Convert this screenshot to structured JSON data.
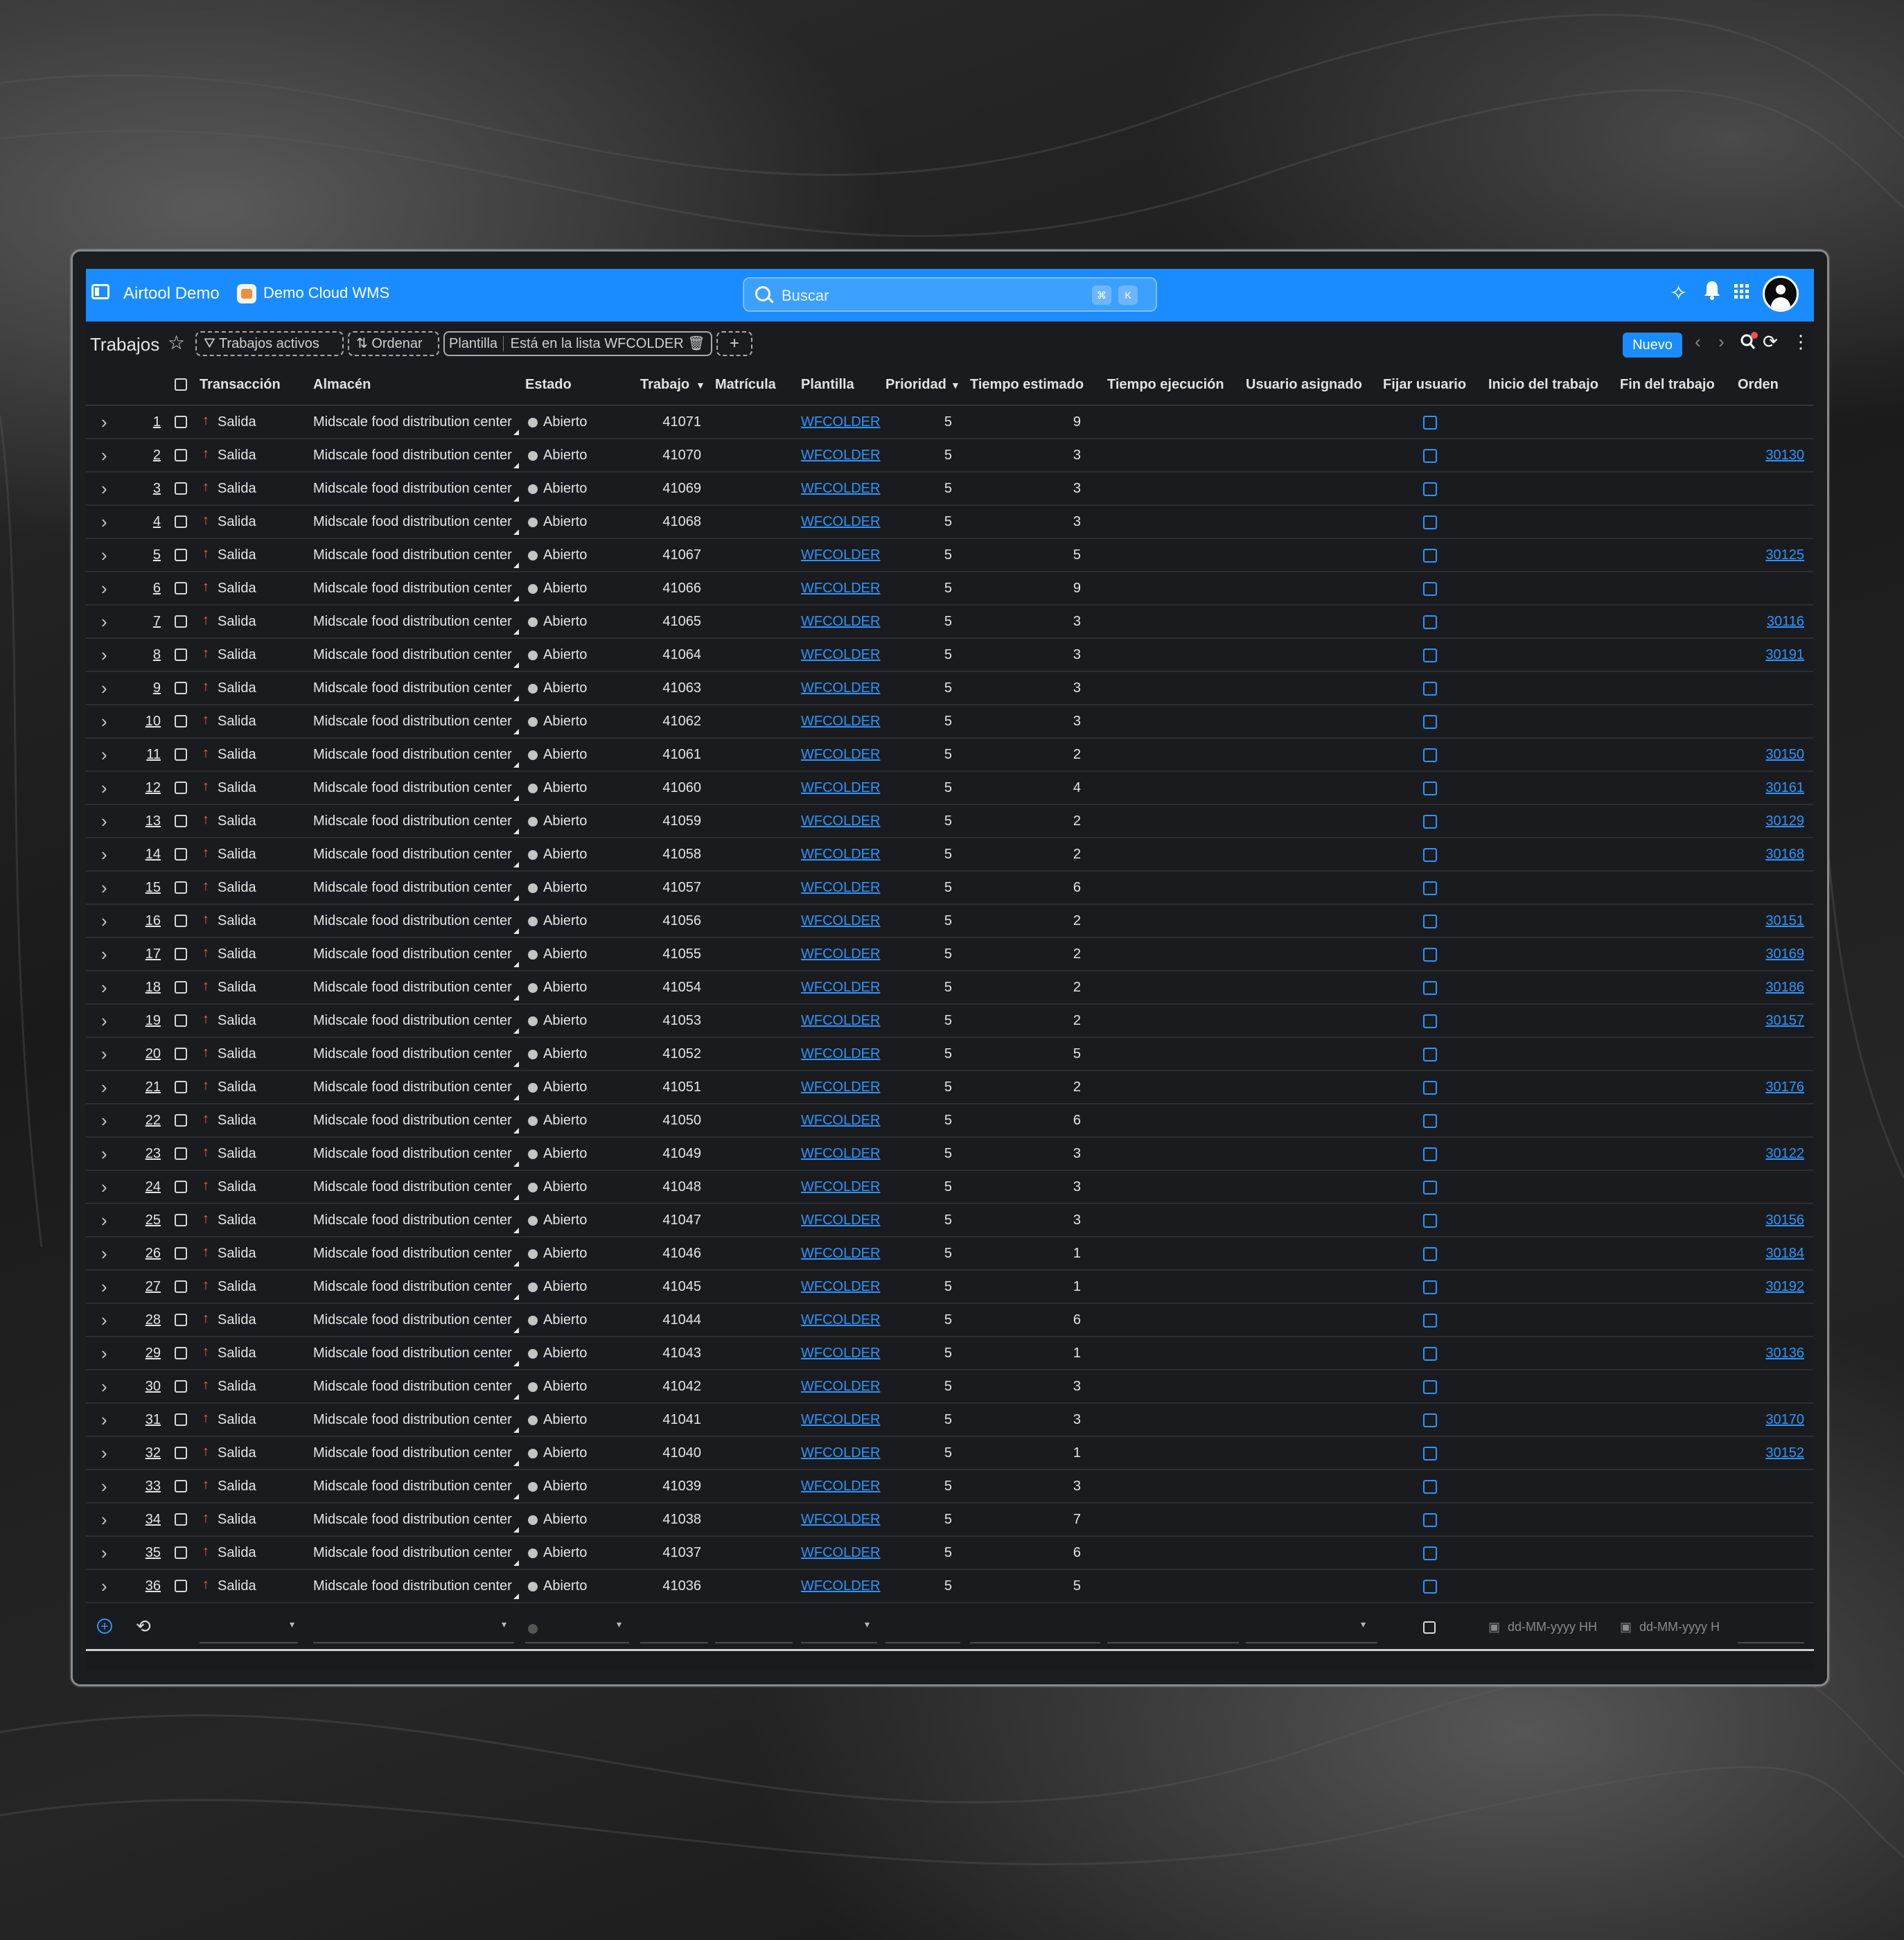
{
  "topbar": {
    "app_title": "Airtool Demo",
    "env_title": "Demo Cloud WMS",
    "search_placeholder": "Buscar",
    "shortcut_keys": [
      "⌘",
      "K"
    ]
  },
  "toolbar": {
    "page_title": "Trabajos",
    "filter_chip": "Trabajos activos",
    "sort_chip": "Ordenar",
    "template_filter_field": "Plantilla",
    "template_filter_value": "Está en la lista WFCOLDER",
    "add_label": "+",
    "new_button": "Nuevo"
  },
  "columns": [
    "Transacción",
    "Almacén",
    "Estado",
    "Trabajo",
    "Matrícula",
    "Plantilla",
    "Prioridad",
    "Tiempo estimado",
    "Tiempo ejecución",
    "Usuario asignado",
    "Fijar usuario",
    "Inicio del trabajo",
    "Fin del trabajo",
    "Orden"
  ],
  "rows": [
    {
      "n": "1",
      "tx": "Salida",
      "wh": "Midscale food distribution center",
      "st": "Abierto",
      "job": "41071",
      "tpl": "WFCOLDER",
      "pri": "5",
      "est": "9",
      "ord": ""
    },
    {
      "n": "2",
      "tx": "Salida",
      "wh": "Midscale food distribution center",
      "st": "Abierto",
      "job": "41070",
      "tpl": "WFCOLDER",
      "pri": "5",
      "est": "3",
      "ord": "30130"
    },
    {
      "n": "3",
      "tx": "Salida",
      "wh": "Midscale food distribution center",
      "st": "Abierto",
      "job": "41069",
      "tpl": "WFCOLDER",
      "pri": "5",
      "est": "3",
      "ord": ""
    },
    {
      "n": "4",
      "tx": "Salida",
      "wh": "Midscale food distribution center",
      "st": "Abierto",
      "job": "41068",
      "tpl": "WFCOLDER",
      "pri": "5",
      "est": "3",
      "ord": ""
    },
    {
      "n": "5",
      "tx": "Salida",
      "wh": "Midscale food distribution center",
      "st": "Abierto",
      "job": "41067",
      "tpl": "WFCOLDER",
      "pri": "5",
      "est": "5",
      "ord": "30125"
    },
    {
      "n": "6",
      "tx": "Salida",
      "wh": "Midscale food distribution center",
      "st": "Abierto",
      "job": "41066",
      "tpl": "WFCOLDER",
      "pri": "5",
      "est": "9",
      "ord": ""
    },
    {
      "n": "7",
      "tx": "Salida",
      "wh": "Midscale food distribution center",
      "st": "Abierto",
      "job": "41065",
      "tpl": "WFCOLDER",
      "pri": "5",
      "est": "3",
      "ord": "30116"
    },
    {
      "n": "8",
      "tx": "Salida",
      "wh": "Midscale food distribution center",
      "st": "Abierto",
      "job": "41064",
      "tpl": "WFCOLDER",
      "pri": "5",
      "est": "3",
      "ord": "30191"
    },
    {
      "n": "9",
      "tx": "Salida",
      "wh": "Midscale food distribution center",
      "st": "Abierto",
      "job": "41063",
      "tpl": "WFCOLDER",
      "pri": "5",
      "est": "3",
      "ord": ""
    },
    {
      "n": "10",
      "tx": "Salida",
      "wh": "Midscale food distribution center",
      "st": "Abierto",
      "job": "41062",
      "tpl": "WFCOLDER",
      "pri": "5",
      "est": "3",
      "ord": ""
    },
    {
      "n": "11",
      "tx": "Salida",
      "wh": "Midscale food distribution center",
      "st": "Abierto",
      "job": "41061",
      "tpl": "WFCOLDER",
      "pri": "5",
      "est": "2",
      "ord": "30150"
    },
    {
      "n": "12",
      "tx": "Salida",
      "wh": "Midscale food distribution center",
      "st": "Abierto",
      "job": "41060",
      "tpl": "WFCOLDER",
      "pri": "5",
      "est": "4",
      "ord": "30161"
    },
    {
      "n": "13",
      "tx": "Salida",
      "wh": "Midscale food distribution center",
      "st": "Abierto",
      "job": "41059",
      "tpl": "WFCOLDER",
      "pri": "5",
      "est": "2",
      "ord": "30129"
    },
    {
      "n": "14",
      "tx": "Salida",
      "wh": "Midscale food distribution center",
      "st": "Abierto",
      "job": "41058",
      "tpl": "WFCOLDER",
      "pri": "5",
      "est": "2",
      "ord": "30168"
    },
    {
      "n": "15",
      "tx": "Salida",
      "wh": "Midscale food distribution center",
      "st": "Abierto",
      "job": "41057",
      "tpl": "WFCOLDER",
      "pri": "5",
      "est": "6",
      "ord": ""
    },
    {
      "n": "16",
      "tx": "Salida",
      "wh": "Midscale food distribution center",
      "st": "Abierto",
      "job": "41056",
      "tpl": "WFCOLDER",
      "pri": "5",
      "est": "2",
      "ord": "30151"
    },
    {
      "n": "17",
      "tx": "Salida",
      "wh": "Midscale food distribution center",
      "st": "Abierto",
      "job": "41055",
      "tpl": "WFCOLDER",
      "pri": "5",
      "est": "2",
      "ord": "30169"
    },
    {
      "n": "18",
      "tx": "Salida",
      "wh": "Midscale food distribution center",
      "st": "Abierto",
      "job": "41054",
      "tpl": "WFCOLDER",
      "pri": "5",
      "est": "2",
      "ord": "30186"
    },
    {
      "n": "19",
      "tx": "Salida",
      "wh": "Midscale food distribution center",
      "st": "Abierto",
      "job": "41053",
      "tpl": "WFCOLDER",
      "pri": "5",
      "est": "2",
      "ord": "30157"
    },
    {
      "n": "20",
      "tx": "Salida",
      "wh": "Midscale food distribution center",
      "st": "Abierto",
      "job": "41052",
      "tpl": "WFCOLDER",
      "pri": "5",
      "est": "5",
      "ord": ""
    },
    {
      "n": "21",
      "tx": "Salida",
      "wh": "Midscale food distribution center",
      "st": "Abierto",
      "job": "41051",
      "tpl": "WFCOLDER",
      "pri": "5",
      "est": "2",
      "ord": "30176"
    },
    {
      "n": "22",
      "tx": "Salida",
      "wh": "Midscale food distribution center",
      "st": "Abierto",
      "job": "41050",
      "tpl": "WFCOLDER",
      "pri": "5",
      "est": "6",
      "ord": ""
    },
    {
      "n": "23",
      "tx": "Salida",
      "wh": "Midscale food distribution center",
      "st": "Abierto",
      "job": "41049",
      "tpl": "WFCOLDER",
      "pri": "5",
      "est": "3",
      "ord": "30122"
    },
    {
      "n": "24",
      "tx": "Salida",
      "wh": "Midscale food distribution center",
      "st": "Abierto",
      "job": "41048",
      "tpl": "WFCOLDER",
      "pri": "5",
      "est": "3",
      "ord": ""
    },
    {
      "n": "25",
      "tx": "Salida",
      "wh": "Midscale food distribution center",
      "st": "Abierto",
      "job": "41047",
      "tpl": "WFCOLDER",
      "pri": "5",
      "est": "3",
      "ord": "30156"
    },
    {
      "n": "26",
      "tx": "Salida",
      "wh": "Midscale food distribution center",
      "st": "Abierto",
      "job": "41046",
      "tpl": "WFCOLDER",
      "pri": "5",
      "est": "1",
      "ord": "30184"
    },
    {
      "n": "27",
      "tx": "Salida",
      "wh": "Midscale food distribution center",
      "st": "Abierto",
      "job": "41045",
      "tpl": "WFCOLDER",
      "pri": "5",
      "est": "1",
      "ord": "30192"
    },
    {
      "n": "28",
      "tx": "Salida",
      "wh": "Midscale food distribution center",
      "st": "Abierto",
      "job": "41044",
      "tpl": "WFCOLDER",
      "pri": "5",
      "est": "6",
      "ord": ""
    },
    {
      "n": "29",
      "tx": "Salida",
      "wh": "Midscale food distribution center",
      "st": "Abierto",
      "job": "41043",
      "tpl": "WFCOLDER",
      "pri": "5",
      "est": "1",
      "ord": "30136"
    },
    {
      "n": "30",
      "tx": "Salida",
      "wh": "Midscale food distribution center",
      "st": "Abierto",
      "job": "41042",
      "tpl": "WFCOLDER",
      "pri": "5",
      "est": "3",
      "ord": ""
    },
    {
      "n": "31",
      "tx": "Salida",
      "wh": "Midscale food distribution center",
      "st": "Abierto",
      "job": "41041",
      "tpl": "WFCOLDER",
      "pri": "5",
      "est": "3",
      "ord": "30170"
    },
    {
      "n": "32",
      "tx": "Salida",
      "wh": "Midscale food distribution center",
      "st": "Abierto",
      "job": "41040",
      "tpl": "WFCOLDER",
      "pri": "5",
      "est": "1",
      "ord": "30152"
    },
    {
      "n": "33",
      "tx": "Salida",
      "wh": "Midscale food distribution center",
      "st": "Abierto",
      "job": "41039",
      "tpl": "WFCOLDER",
      "pri": "5",
      "est": "3",
      "ord": ""
    },
    {
      "n": "34",
      "tx": "Salida",
      "wh": "Midscale food distribution center",
      "st": "Abierto",
      "job": "41038",
      "tpl": "WFCOLDER",
      "pri": "5",
      "est": "7",
      "ord": ""
    },
    {
      "n": "35",
      "tx": "Salida",
      "wh": "Midscale food distribution center",
      "st": "Abierto",
      "job": "41037",
      "tpl": "WFCOLDER",
      "pri": "5",
      "est": "6",
      "ord": ""
    },
    {
      "n": "36",
      "tx": "Salida",
      "wh": "Midscale food distribution center",
      "st": "Abierto",
      "job": "41036",
      "tpl": "WFCOLDER",
      "pri": "5",
      "est": "5",
      "ord": ""
    }
  ],
  "filter_row": {
    "start_placeholder": "dd-MM-yyyy HH",
    "end_placeholder": "dd-MM-yyyy H"
  },
  "colors": {
    "accent": "#1a8cff",
    "link": "#2d95ff",
    "outbound_arrow": "#ff5a4f",
    "background": "#1a1b1e"
  }
}
